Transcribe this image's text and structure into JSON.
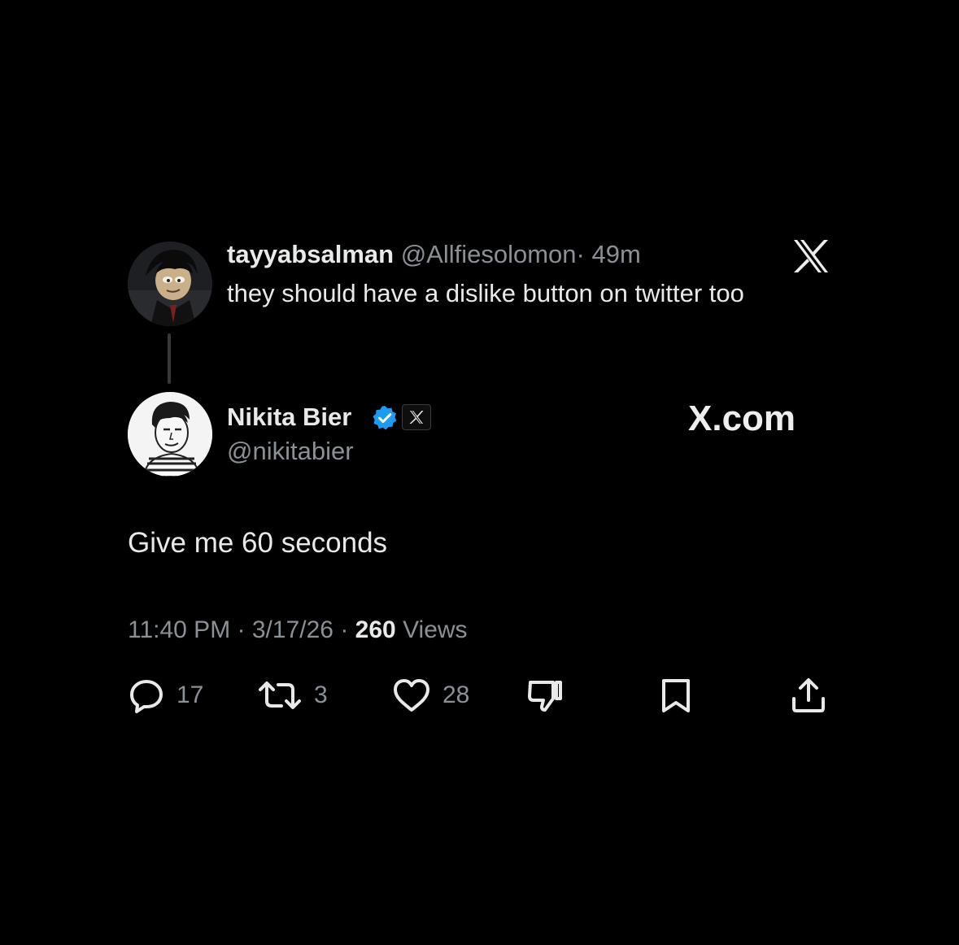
{
  "parent_tweet": {
    "display_name": "tayyabsalman",
    "handle": "@Allfiesolomon",
    "separator": "·",
    "time": "49m",
    "text": "they should have a dislike button on twitter too",
    "avatar_icon": "cartoon-avatar-icon"
  },
  "watermark": {
    "logo_icon": "x-logo-icon",
    "brand_text": "X.com"
  },
  "main_tweet": {
    "display_name": "Nikita Bier",
    "handle": "@nikitabier",
    "verified_icon": "verified-badge-icon",
    "affiliate_icon": "x-affiliate-badge-icon",
    "text": "Give me 60 seconds",
    "time": "11:40 PM",
    "date": "3/17/26",
    "views_count": "260",
    "views_label": "Views",
    "separator": "·"
  },
  "actions": {
    "reply_count": "17",
    "retweet_count": "3",
    "like_count": "28"
  },
  "colors": {
    "background": "#000000",
    "text_primary": "#e7e9ea",
    "text_secondary": "#8b9096",
    "verified_blue": "#1d9bf0",
    "thread_line": "#38393c"
  }
}
